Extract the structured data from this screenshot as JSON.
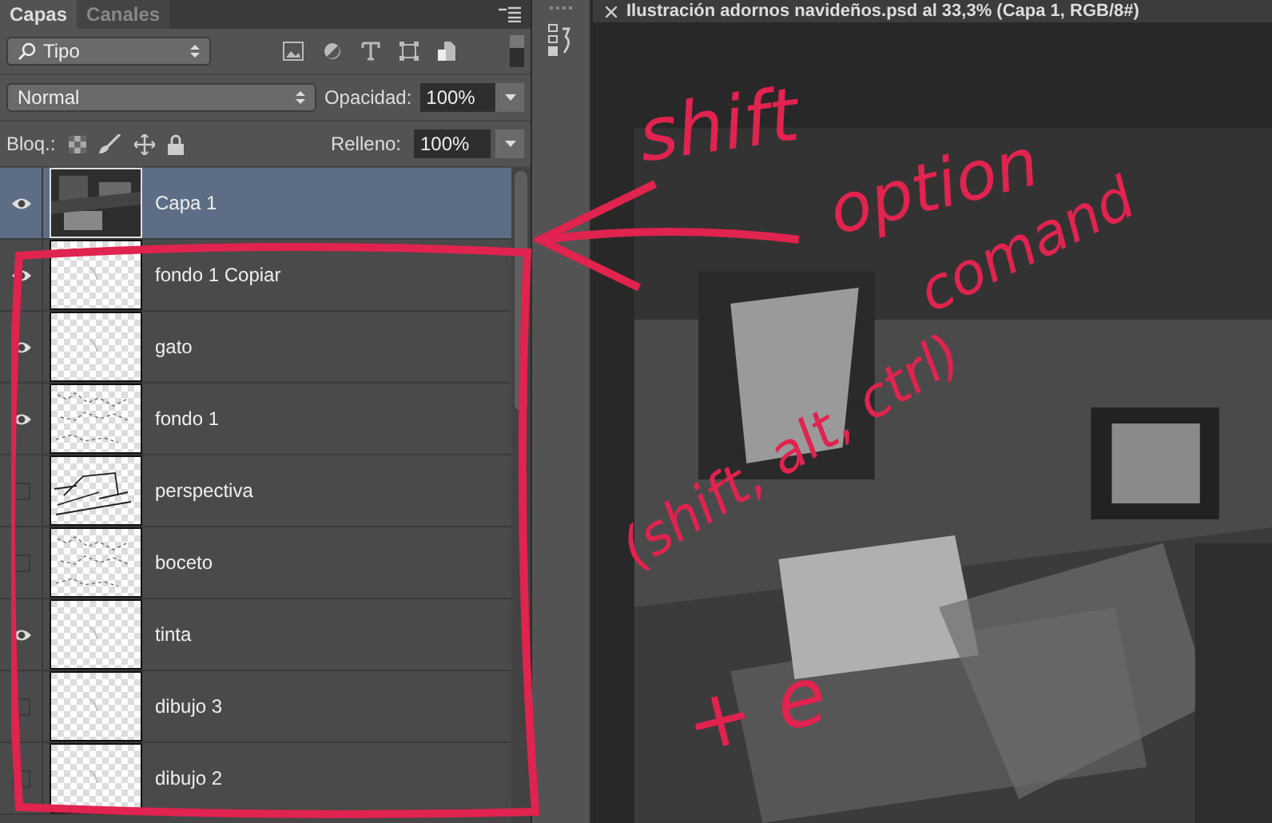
{
  "panel": {
    "tabs": [
      {
        "label": "Capas",
        "selected": true
      },
      {
        "label": "Canales",
        "selected": false
      }
    ],
    "filter": {
      "value": "Tipo"
    },
    "blend_mode": {
      "value": "Normal"
    },
    "opacity": {
      "label": "Opacidad:",
      "value": "100%"
    },
    "lock": {
      "label": "Bloq.:"
    },
    "fill": {
      "label": "Relleno:",
      "value": "100%"
    },
    "layers": [
      {
        "name": "Capa 1",
        "visible": true,
        "selected": true,
        "kind": "picture"
      },
      {
        "name": "fondo 1 Copiar",
        "visible": true,
        "selected": false,
        "kind": "transparent"
      },
      {
        "name": "gato",
        "visible": true,
        "selected": false,
        "kind": "transparent"
      },
      {
        "name": "fondo 1",
        "visible": true,
        "selected": false,
        "kind": "sketch"
      },
      {
        "name": "perspectiva",
        "visible": false,
        "selected": false,
        "kind": "lines"
      },
      {
        "name": "boceto",
        "visible": false,
        "selected": false,
        "kind": "sketch"
      },
      {
        "name": "tinta",
        "visible": true,
        "selected": false,
        "kind": "transparent"
      },
      {
        "name": "dibujo 3",
        "visible": false,
        "selected": false,
        "kind": "transparent"
      },
      {
        "name": "dibujo 2",
        "visible": false,
        "selected": false,
        "kind": "transparent"
      }
    ]
  },
  "document": {
    "title": "Ilustración adornos navideños.psd al 33,3% (Capa 1, RGB/8#)"
  },
  "annotations": [
    {
      "text": "shift"
    },
    {
      "text": "option"
    },
    {
      "text": "comand"
    },
    {
      "text": "(shift, alt, ctrl)"
    },
    {
      "text": "+ e"
    }
  ]
}
